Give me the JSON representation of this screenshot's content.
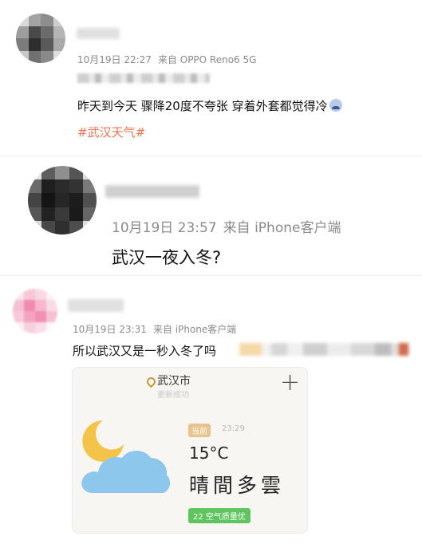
{
  "posts": [
    {
      "meta": {
        "time": "10月19日 22:27",
        "source": "来自 OPPO Reno6 5G"
      },
      "text": "昨天到今天 骤降20度不夸张 穿着外套都觉得冷",
      "emoji_icon": "cold-face-emoji",
      "hashtag": "#武汉天气#"
    },
    {
      "meta": {
        "time": "10月19日 23:57",
        "source": "来自 iPhone客户端"
      },
      "text": "武汉一夜入冬?"
    },
    {
      "meta": {
        "time": "10月19日 23:31",
        "source": "来自 iPhone客户端"
      },
      "text": "所以武汉又是一秒入冬了吗",
      "weather_card": {
        "city": "武汉市",
        "location_sub": "更新成功",
        "add_icon": "plus-icon",
        "weather_icon": "moon-cloud-icon",
        "badge": "当前",
        "time": "23:29",
        "temperature": "15°C",
        "condition": "晴間多雲",
        "aqi": "22 空气质量优"
      }
    }
  ],
  "colors": {
    "hashtag": "#eb7350",
    "aqi": "#5fc45e",
    "meta": "#8a8a8a",
    "badge": "#e7c38e"
  }
}
